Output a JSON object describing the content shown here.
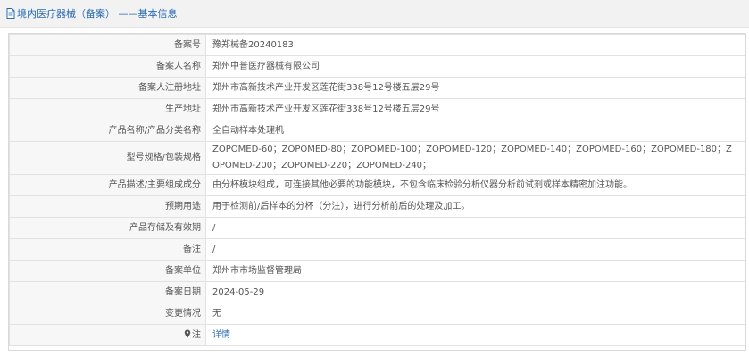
{
  "page": {
    "title": "境内医疗器械（备案） ——基本信息"
  },
  "rows": {
    "record_no": {
      "label": "备案号",
      "value": "豫郑械备20240183"
    },
    "filer_name": {
      "label": "备案人名称",
      "value": "郑州中普医疗器械有限公司"
    },
    "filer_address": {
      "label": "备案人注册地址",
      "value": "郑州市高新技术产业开发区莲花街338号12号楼五层29号"
    },
    "production_address": {
      "label": "生产地址",
      "value": "郑州市高新技术产业开发区莲花街338号12号楼五层29号"
    },
    "product_name": {
      "label": "产品名称/产品分类名称",
      "value": "全自动样本处理机"
    },
    "model_spec": {
      "label": "型号规格/包装规格",
      "value": "ZOPOMED-60；ZOPOMED-80；ZOPOMED-100；ZOPOMED-120；ZOPOMED-140；ZOPOMED-160；ZOPOMED-180；ZOPOMED-200；ZOPOMED-220；ZOPOMED-240；"
    },
    "description": {
      "label": "产品描述/主要组成成分",
      "value": "由分杯模块组成，可连接其他必要的功能模块，不包含临床检验分析仪器分析前试剂或样本精密加注功能。"
    },
    "intended_use": {
      "label": "预期用途",
      "value": "用于检测前/后样本的分杯（分注），进行分析前后的处理及加工。"
    },
    "storage": {
      "label": "产品存储及有效期",
      "value": "/"
    },
    "remarks": {
      "label": "备注",
      "value": "/"
    },
    "record_unit": {
      "label": "备案单位",
      "value": "郑州市市场监督管理局"
    },
    "record_date": {
      "label": "备案日期",
      "value": "2024-05-29"
    },
    "change": {
      "label": "变更情况",
      "value": "无"
    },
    "note": {
      "label": "注",
      "value": "详情"
    }
  },
  "colors": {
    "link": "#2b6cb0",
    "label_bg": "#f7f7f7",
    "titlebar_bg": "#f2f2f2",
    "border": "#e2e2e2"
  },
  "icons": [
    "document-icon",
    "map-pin-icon"
  ]
}
